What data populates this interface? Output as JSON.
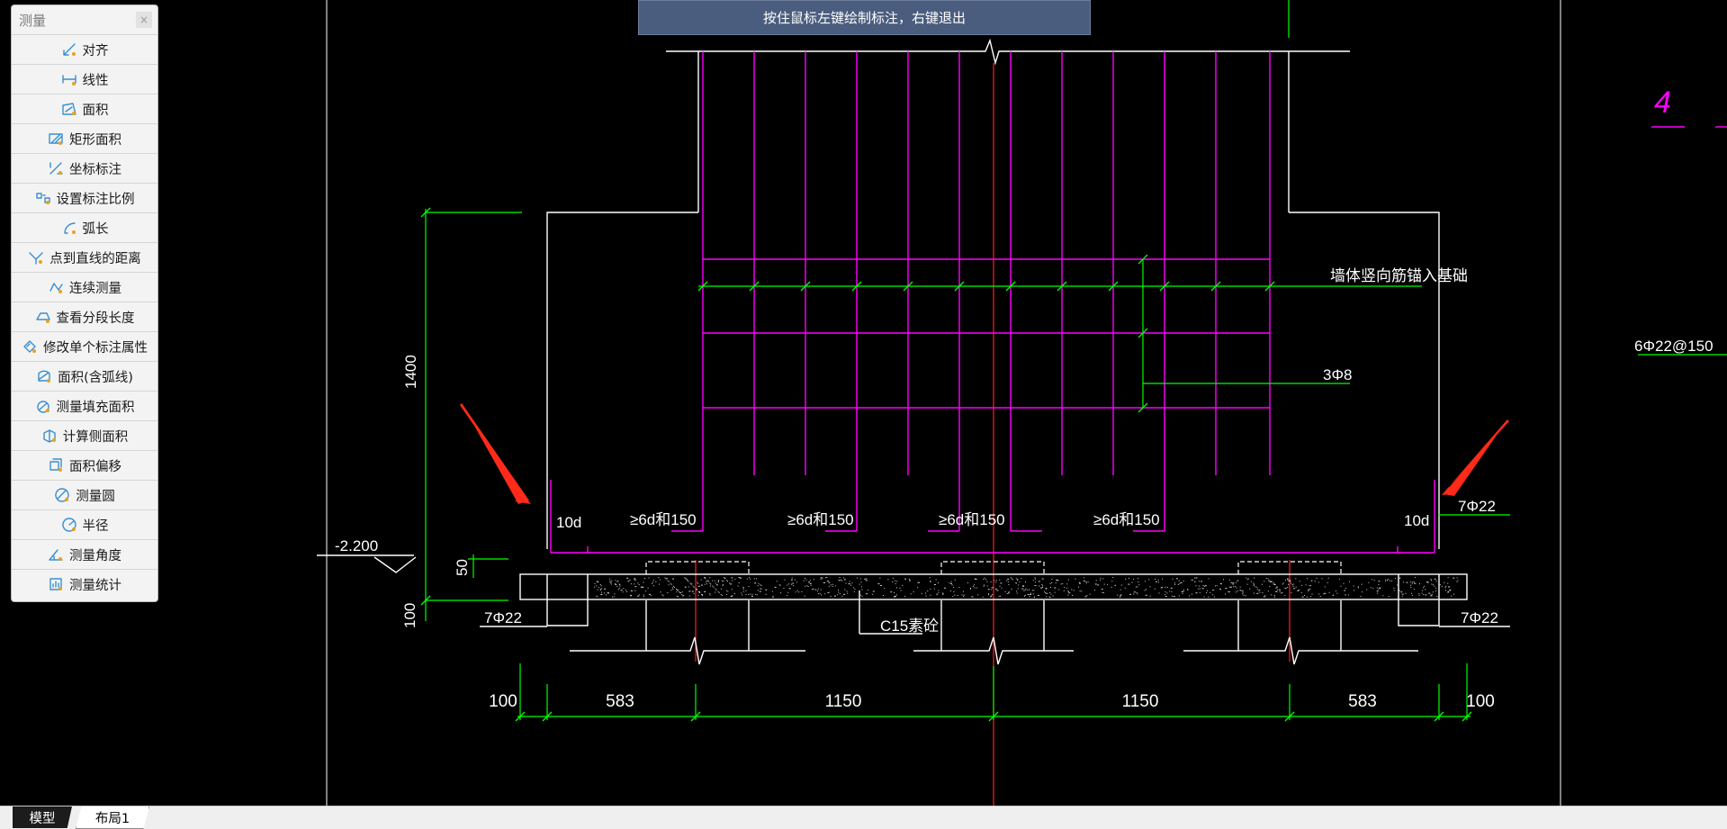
{
  "hint": "按住鼠标左键绘制标注，右键退出",
  "panel": {
    "title": "测量",
    "close_label": "×",
    "tools": [
      {
        "label": "对齐",
        "icon": "align-measure-icon"
      },
      {
        "label": "线性",
        "icon": "linear-measure-icon"
      },
      {
        "label": "面积",
        "icon": "area-icon"
      },
      {
        "label": "矩形面积",
        "icon": "rect-area-icon"
      },
      {
        "label": "坐标标注",
        "icon": "coordinate-icon"
      },
      {
        "label": "设置标注比例",
        "icon": "scale-ratio-icon"
      },
      {
        "label": "弧长",
        "icon": "arc-length-icon"
      },
      {
        "label": "点到直线的距离",
        "icon": "point-line-distance-icon"
      },
      {
        "label": "连续测量",
        "icon": "continuous-measure-icon"
      },
      {
        "label": "查看分段长度",
        "icon": "segment-length-icon"
      },
      {
        "label": "修改单个标注属性",
        "icon": "edit-dimension-icon"
      },
      {
        "label": "面积(含弧线)",
        "icon": "arc-area-icon"
      },
      {
        "label": "测量填充面积",
        "icon": "hatch-area-icon"
      },
      {
        "label": "计算侧面积",
        "icon": "side-area-icon"
      },
      {
        "label": "面积偏移",
        "icon": "area-offset-icon"
      },
      {
        "label": "测量圆",
        "icon": "circle-measure-icon"
      },
      {
        "label": "半径",
        "icon": "radius-icon"
      },
      {
        "label": "测量角度",
        "icon": "angle-icon"
      },
      {
        "label": "测量统计",
        "icon": "statistics-icon"
      }
    ]
  },
  "drawing": {
    "labels": {
      "wall_anchor": "墙体竖向筋锚入基础",
      "stirrup": "3Φ8",
      "side_rebar": "6Φ22@150",
      "elevation": "-2.200",
      "height_dim": "1400",
      "slab_dim": "50",
      "cushion_dim": "100",
      "rebar_bottom_left": "7Φ22",
      "rebar_bottom_right": "7Φ22",
      "rebar_top_right": "7Φ22",
      "hook_left": "10d",
      "hook_right": "10d",
      "bend_1": "≥6d和150",
      "bend_2": "≥6d和150",
      "bend_3": "≥6d和150",
      "bend_4": "≥6d和150",
      "cushion": "C15素砼",
      "axis_tag": "4"
    },
    "bottom_dims": [
      "100",
      "583",
      "1150",
      "1150",
      "583",
      "100"
    ],
    "colors": {
      "white": "#ffffff",
      "magenta": "#ff00ff",
      "green": "#00ff00",
      "red": "#ff0000"
    }
  },
  "tabs": {
    "model": "模型",
    "layout": "布局1"
  }
}
